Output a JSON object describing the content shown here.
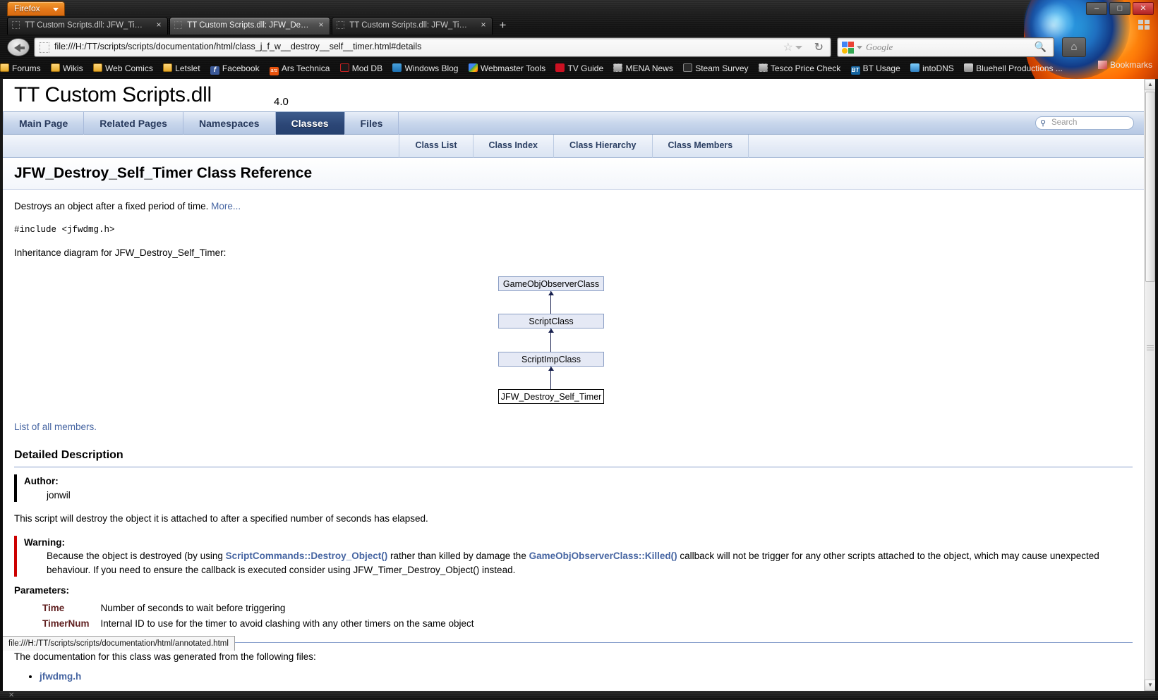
{
  "browser": {
    "app_button": "Firefox",
    "tabs": [
      {
        "title": "TT Custom Scripts.dll: JFW_Timer_De...",
        "active": false,
        "close": "×"
      },
      {
        "title": "TT Custom Scripts.dll: JFW_Destroy_S...",
        "active": true,
        "close": "×"
      },
      {
        "title": "TT Custom Scripts.dll: JFW_Timer_De...",
        "active": false,
        "close": "×"
      }
    ],
    "new_tab_label": "+",
    "url": "file:///H:/TT/scripts/scripts/documentation/html/class_j_f_w__destroy__self__timer.html#details",
    "search_engine": "Google",
    "window_controls": {
      "minimize": "–",
      "maximize": "□",
      "close": "✕"
    },
    "bookmarks": [
      {
        "label": "Forums",
        "icon": "folder-icon"
      },
      {
        "label": "Wikis",
        "icon": "folder-icon"
      },
      {
        "label": "Web Comics",
        "icon": "folder-icon"
      },
      {
        "label": "Letslet",
        "icon": "folder-icon"
      },
      {
        "label": "Facebook",
        "icon": "facebook-icon"
      },
      {
        "label": "Ars Technica",
        "icon": "ars-technica-icon"
      },
      {
        "label": "Mod DB",
        "icon": "moddb-icon"
      },
      {
        "label": "Windows Blog",
        "icon": "windows-blog-icon"
      },
      {
        "label": "Webmaster Tools",
        "icon": "google-icon"
      },
      {
        "label": "TV Guide",
        "icon": "tvguide-icon"
      },
      {
        "label": "MENA News",
        "icon": "generic-site-icon"
      },
      {
        "label": "Steam Survey",
        "icon": "steam-icon"
      },
      {
        "label": "Tesco Price Check",
        "icon": "generic-site-icon"
      },
      {
        "label": "BT Usage",
        "icon": "bt-icon"
      },
      {
        "label": "intoDNS",
        "icon": "dns-icon"
      },
      {
        "label": "Bluehell Productions ...",
        "icon": "bluehell-icon"
      }
    ],
    "bookmarks_overflow_label": "Bookmarks",
    "status_popup": "file:///H:/TT/scripts/scripts/documentation/html/annotated.html"
  },
  "page": {
    "project_name": "TT Custom Scripts.dll",
    "project_number": "4.0",
    "main_tabs": [
      {
        "label": "Main Page",
        "current": false
      },
      {
        "label": "Related Pages",
        "current": false
      },
      {
        "label": "Namespaces",
        "current": false
      },
      {
        "label": "Classes",
        "current": true
      },
      {
        "label": "Files",
        "current": false
      }
    ],
    "search": {
      "placeholder": "Search",
      "icon": "search-icon"
    },
    "sub_tabs": [
      {
        "label": "Class List"
      },
      {
        "label": "Class Index"
      },
      {
        "label": "Class Hierarchy"
      },
      {
        "label": "Class Members"
      }
    ],
    "header_title": "JFW_Destroy_Self_Timer Class Reference",
    "brief": "Destroys an object after a fixed period of time.",
    "brief_more": "More...",
    "include_line": "#include <jfwdmg.h>",
    "inherit_caption": "Inheritance diagram for JFW_Destroy_Self_Timer:",
    "inherit_boxes": [
      {
        "label": "GameObjObserverClass",
        "kind": "base"
      },
      {
        "label": "ScriptClass",
        "kind": "base"
      },
      {
        "label": "ScriptImpClass",
        "kind": "base"
      },
      {
        "label": "JFW_Destroy_Self_Timer",
        "kind": "leaf"
      }
    ],
    "list_all_members": "List of all members.",
    "detailed_description_heading": "Detailed Description",
    "author_label": "Author:",
    "author_value": "jonwil",
    "description_paragraph": "This script will destroy the object it is attached to after a specified number of seconds has elapsed.",
    "warning_label": "Warning:",
    "warning_text_1": "Because the object is destroyed (by using ",
    "warning_link_1": "ScriptCommands::Destroy_Object()",
    "warning_text_2": " rather than killed by damage the ",
    "warning_link_2": "GameObjObserverClass::Killed()",
    "warning_text_3": " callback will not be trigger for any other scripts attached to the object, which may cause unexpected behaviour. If you need to ensure the callback is executed consider using JFW_Timer_Destroy_Object() instead.",
    "parameters_label": "Parameters:",
    "parameters": [
      {
        "name": "Time",
        "desc": "Number of seconds to wait before triggering"
      },
      {
        "name": "TimerNum",
        "desc": "Internal ID to use for the timer to avoid clashing with any other timers on the same object"
      }
    ],
    "footer_text": "The documentation for this class was generated from the following files:",
    "files": [
      {
        "label": "jfwdmg.h"
      }
    ]
  },
  "colors": {
    "accent_blue": "#4665a2",
    "tab_active": "#2c4676",
    "warning_bar": "#cc0000",
    "param_name": "#602020",
    "firefox_orange": "#e5791a"
  }
}
